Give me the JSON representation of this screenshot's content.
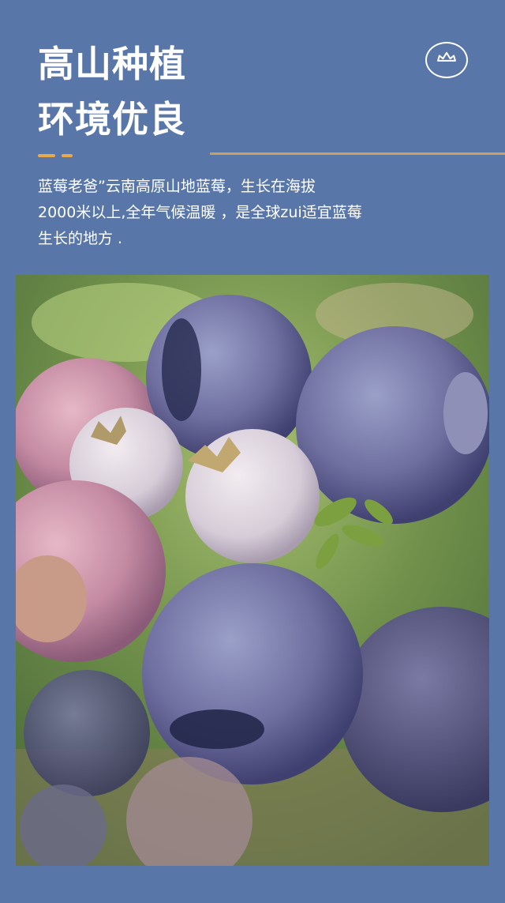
{
  "heading": {
    "line1": "高山种植",
    "line2": "环境优良"
  },
  "logo_icon": "blueberry-crown-icon",
  "description": {
    "line1": "蓝莓老爸”云南高原山地蓝莓，生长在海拔",
    "line2": "2000米以上,全年气候温暖  ，是全球zui适宜蓝莓",
    "line3": "生长的地方 ."
  },
  "colors": {
    "background": "#5876a8",
    "accent": "#e8a94a",
    "text": "#ffffff"
  }
}
